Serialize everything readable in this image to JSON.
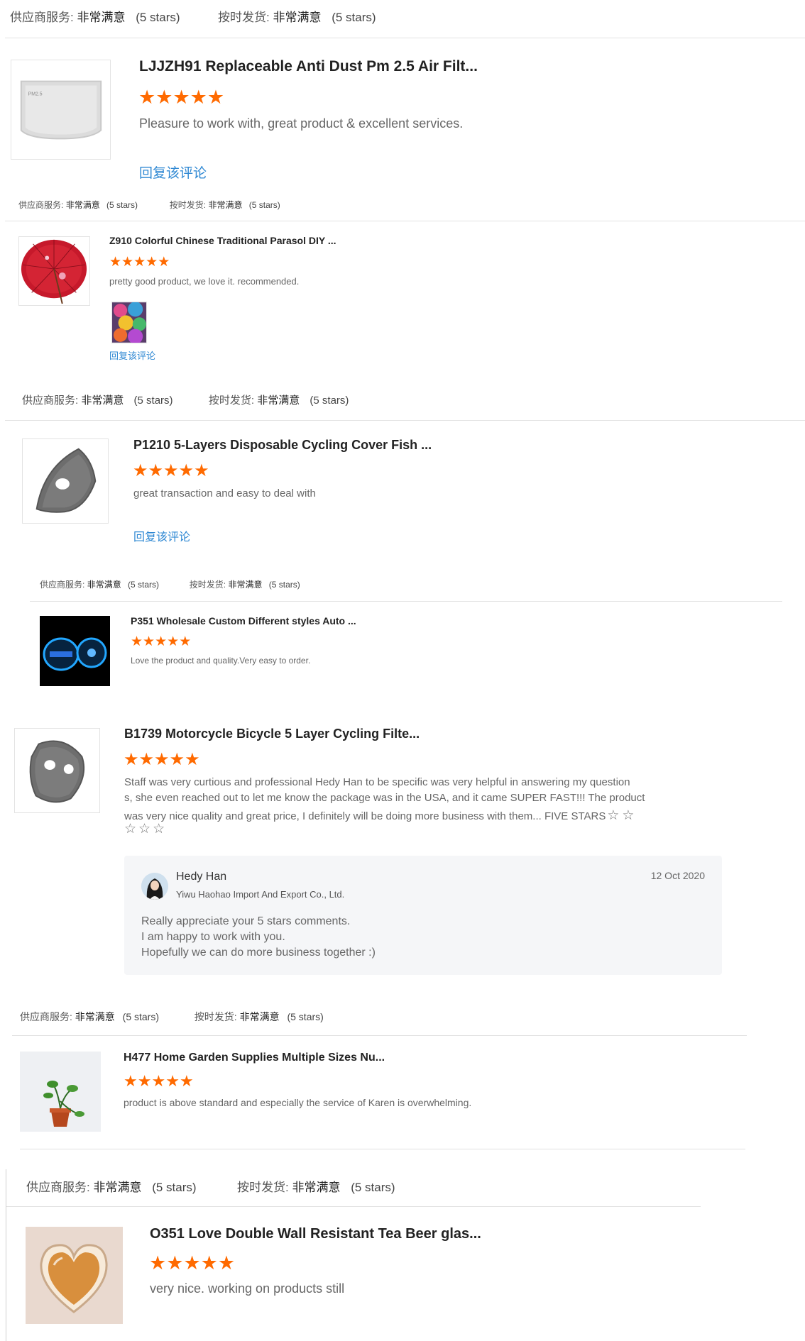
{
  "rating_labels": {
    "service": "供应商服务:",
    "delivery": "按时发货:",
    "value": "非常满意",
    "stars": "(5 stars)"
  },
  "reply_link_label": "回复该评论",
  "reviews": [
    {
      "title": "LJJZH91 Replaceable Anti Dust Pm 2.5 Air Filt...",
      "comment": "Pleasure to work with, great product & excellent services.",
      "thumb_icon": "filter-pad-image"
    },
    {
      "title": "Z910 Colorful Chinese Traditional Parasol DIY ...",
      "comment": "pretty good product, we love it. recommended.",
      "thumb_icon": "red-parasol-image",
      "attachment_icon": "colorful-umbrellas-photo"
    },
    {
      "title": "P1210 5-Layers Disposable Cycling Cover Fish ...",
      "comment": "great transaction and easy to deal with",
      "thumb_icon": "mask-filter-image"
    },
    {
      "title": "P351 Wholesale Custom Different styles Auto ...",
      "comment": "Love the product and quality.Very easy to order.",
      "thumb_icon": "led-coaster-image"
    },
    {
      "title": "B1739 Motorcycle Bicycle 5 Layer Cycling Filte...",
      "comment_lines": [
        "Staff was very curtious and professional Hedy Han to be specific was very helpful in answering my question",
        "s, she even reached out to let me know the package was in the USA, and it came SUPER FAST!!! The product",
        "was very nice quality and great price, I definitely will be doing more business with them... FIVE STARS"
      ],
      "thumb_icon": "cycling-mask-filter-image",
      "reply": {
        "name": "Hedy Han",
        "company": "Yiwu Haohao Import And Export Co., Ltd.",
        "date": "12 Oct 2020",
        "lines": [
          "Really appreciate your 5 stars comments.",
          "I am happy to work with you.",
          "Hopefully we can do more business together :)"
        ]
      }
    },
    {
      "title": "H477 Home Garden Supplies Multiple Sizes Nu...",
      "comment": "product is above standard and especially the service of Karen is overwhelming.",
      "thumb_icon": "potted-plant-image"
    },
    {
      "title": "O351 Love Double Wall Resistant Tea Beer glas...",
      "comment": "very nice. working on products still",
      "thumb_icon": "heart-glass-cup-image"
    }
  ],
  "colors": {
    "star": "#ff6a00",
    "link": "#2f88d3",
    "reply_bg": "#f5f6f8"
  }
}
